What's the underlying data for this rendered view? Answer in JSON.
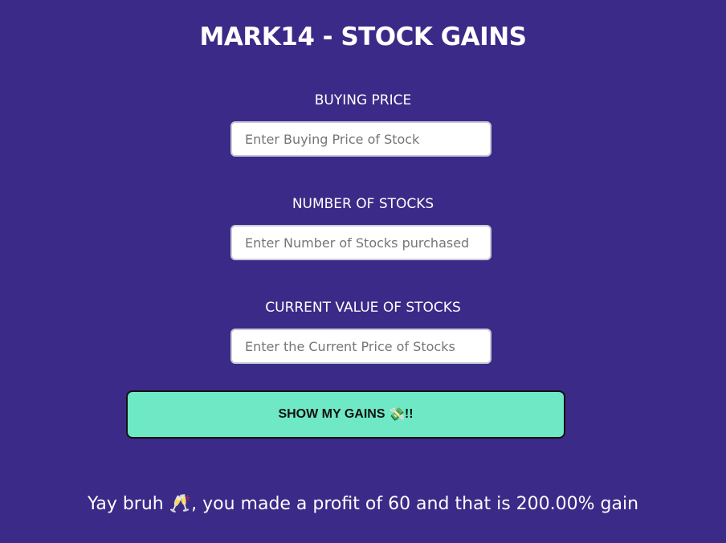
{
  "header": {
    "title": "MARK14 - STOCK GAINS"
  },
  "form": {
    "buying_price": {
      "label": "BUYING PRICE",
      "placeholder": "Enter Buying Price of Stock",
      "value": ""
    },
    "number_of_stocks": {
      "label": "NUMBER OF STOCKS",
      "placeholder": "Enter Number of Stocks purchased",
      "value": ""
    },
    "current_value": {
      "label": "CURRENT VALUE OF STOCKS",
      "placeholder": "Enter the Current Price of Stocks",
      "value": ""
    },
    "submit": {
      "label_text": "SHOW MY GAINS ",
      "label_emoji": "💸",
      "label_suffix": "!!"
    }
  },
  "result": {
    "message": "Yay bruh 🥂, you made a profit of 60 and that is 200.00% gain"
  },
  "colors": {
    "background": "#3b2a87",
    "button": "#6ee8c5",
    "text": "#ffffff"
  }
}
